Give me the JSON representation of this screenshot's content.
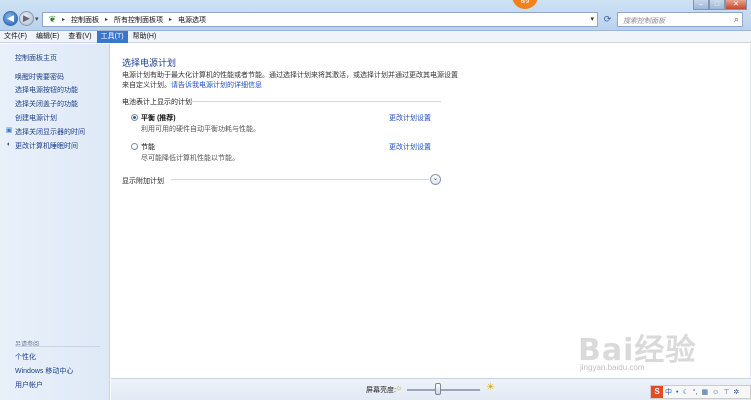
{
  "title_badge": "6/9",
  "address": {
    "crumbs": [
      "控制面板",
      "所有控制面板项",
      "电源选项"
    ],
    "search_placeholder": "搜索控制面板"
  },
  "menu": [
    "文件(F)",
    "编辑(E)",
    "查看(V)",
    "工具(T)",
    "帮助(H)"
  ],
  "menu_active_index": 3,
  "sidebar": {
    "home": "控制面板主页",
    "items": [
      {
        "label": "唤醒时需要密码",
        "icon": ""
      },
      {
        "label": "选择电源按钮的功能",
        "icon": ""
      },
      {
        "label": "选择关闭盖子的功能",
        "icon": ""
      },
      {
        "label": "创建电源计划",
        "icon": ""
      },
      {
        "label": "选择关闭显示器的时间",
        "icon": "monitor-icon"
      },
      {
        "label": "更改计算机睡眠时间",
        "icon": "moon-icon"
      }
    ],
    "see_also_title": "另请参阅",
    "see_also": [
      "个性化",
      "Windows 移动中心",
      "用户帐户"
    ]
  },
  "main": {
    "title": "选择电源计划",
    "desc_line1": "电源计划有助于最大化计算机的性能或者节能。通过选择计划来将其激活，或选择计划并通过更改其电源设置",
    "desc_line2_prefix": "来自定义计划。",
    "desc_link": "请告诉我电源计划的详细信息",
    "section_label": "电池表计上显示的计划",
    "plans": [
      {
        "name": "平衡 (推荐)",
        "desc": "利用可用的硬件自动平衡功耗与性能。",
        "change": "更改计划设置",
        "selected": true
      },
      {
        "name": "节能",
        "desc": "尽可能降低计算机性能以节能。",
        "change": "更改计划设置",
        "selected": false
      }
    ],
    "expander_label": "显示附加计划"
  },
  "bottom": {
    "brightness_label": "屏幕亮度:",
    "brightness_level": 0.42
  },
  "watermark": {
    "text": "Bai经验",
    "url": "jingyan.baidu.com"
  },
  "ime": {
    "logo": "S",
    "lang": "中"
  }
}
